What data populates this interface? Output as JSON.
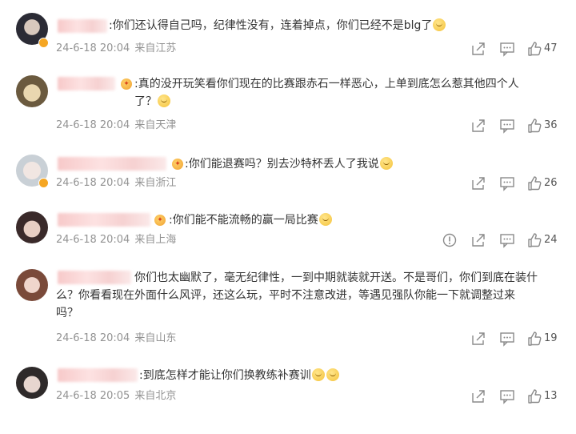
{
  "comments": [
    {
      "text": ":你们还认得自己吗，纪律性没有，连着掉点，你们已经不是blg了",
      "emojis_after": 1,
      "time": "24-6-18 20:04",
      "location": "来自江苏",
      "likes": "47",
      "avatar_colors": [
        "#2b2b35",
        "#d8c8bd"
      ],
      "verified": true,
      "has_report": false
    },
    {
      "text": ":真的没开玩笑看你们现在的比赛跟赤石一样恶心，上单到底怎么惹其他四个人\n了？",
      "emojis_after": 1,
      "time": "24-6-18 20:04",
      "location": "来自天津",
      "likes": "36",
      "avatar_colors": [
        "#6b5a3f",
        "#e9d7b0"
      ],
      "verified": false,
      "has_report": false
    },
    {
      "text": ":你们能退赛吗？别去沙特杯丢人了我说",
      "emojis_after": 1,
      "time": "24-6-18 20:04",
      "location": "来自浙江",
      "likes": "26",
      "avatar_colors": [
        "#c9d0d6",
        "#f1e6e2"
      ],
      "verified": true,
      "has_report": false
    },
    {
      "text": ":你们能不能流畅的赢一局比赛",
      "emojis_after": 1,
      "time": "24-6-18 20:04",
      "location": "来自上海",
      "likes": "24",
      "avatar_colors": [
        "#3a2a2a",
        "#e8cfc4"
      ],
      "verified": false,
      "has_report": true
    },
    {
      "text": "你们也太幽默了，毫无纪律性，一到中期就装就开送。不是哥们，你们到底在装什\n么？你看看现在外面什么风评，还这么玩，平时不注意改进，等遇见强队你能一下就调整过来\n吗？",
      "emojis_after": 0,
      "time": "24-6-18 20:04",
      "location": "来自山东",
      "likes": "19",
      "avatar_colors": [
        "#7a4a3a",
        "#f0d6cc"
      ],
      "verified": false,
      "has_report": false
    },
    {
      "text": ":到底怎样才能让你们换教练补赛训",
      "emojis_after": 2,
      "time": "24-6-18 20:05",
      "location": "来自北京",
      "likes": "13",
      "avatar_colors": [
        "#2e2a2a",
        "#e7d6cf"
      ],
      "verified": false,
      "has_report": false
    }
  ]
}
